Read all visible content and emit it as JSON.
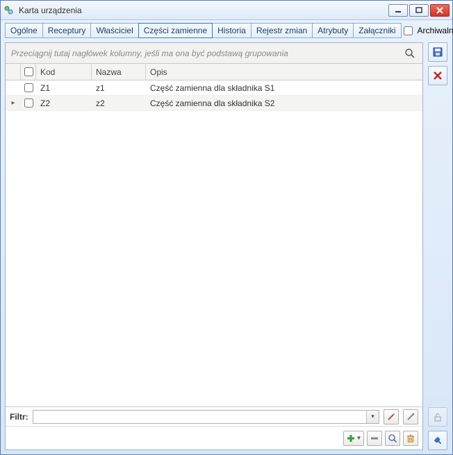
{
  "window": {
    "title": "Karta urządzenia"
  },
  "tabs": [
    {
      "label": "Ogólne",
      "active": false
    },
    {
      "label": "Receptury",
      "active": false
    },
    {
      "label": "Właściciel",
      "active": false
    },
    {
      "label": "Części zamienne",
      "active": true
    },
    {
      "label": "Historia",
      "active": false
    },
    {
      "label": "Rejestr zmian",
      "active": false
    },
    {
      "label": "Atrybuty",
      "active": false
    },
    {
      "label": "Załączniki",
      "active": false
    }
  ],
  "archive": {
    "label": "Archiwalne",
    "checked": false
  },
  "group_hint": "Przeciągnij tutaj nagłówek kolumny, jeśli ma ona być podstawą grupowania",
  "columns": {
    "kod": "Kod",
    "nazwa": "Nazwa",
    "opis": "Opis"
  },
  "rows": [
    {
      "selected": false,
      "active": false,
      "kod": "Z1",
      "nazwa": "z1",
      "opis": "Część zamienna dla składnika S1"
    },
    {
      "selected": false,
      "active": true,
      "kod": "Z2",
      "nazwa": "z2",
      "opis": "Część zamienna dla składnika S2"
    }
  ],
  "filter": {
    "label": "Filtr:",
    "value": ""
  },
  "icons": {
    "save": "save-icon",
    "delete_side": "delete-x-icon",
    "lock": "lock-open-icon",
    "pin": "pin-icon",
    "add": "plus-icon",
    "add_dd": "dropdown-icon",
    "remove": "minus-icon",
    "search_btn": "magnifier-icon",
    "trash": "trash-icon",
    "wand": "wand-icon",
    "wand2": "wand-alt-icon",
    "search_header": "search-icon"
  }
}
